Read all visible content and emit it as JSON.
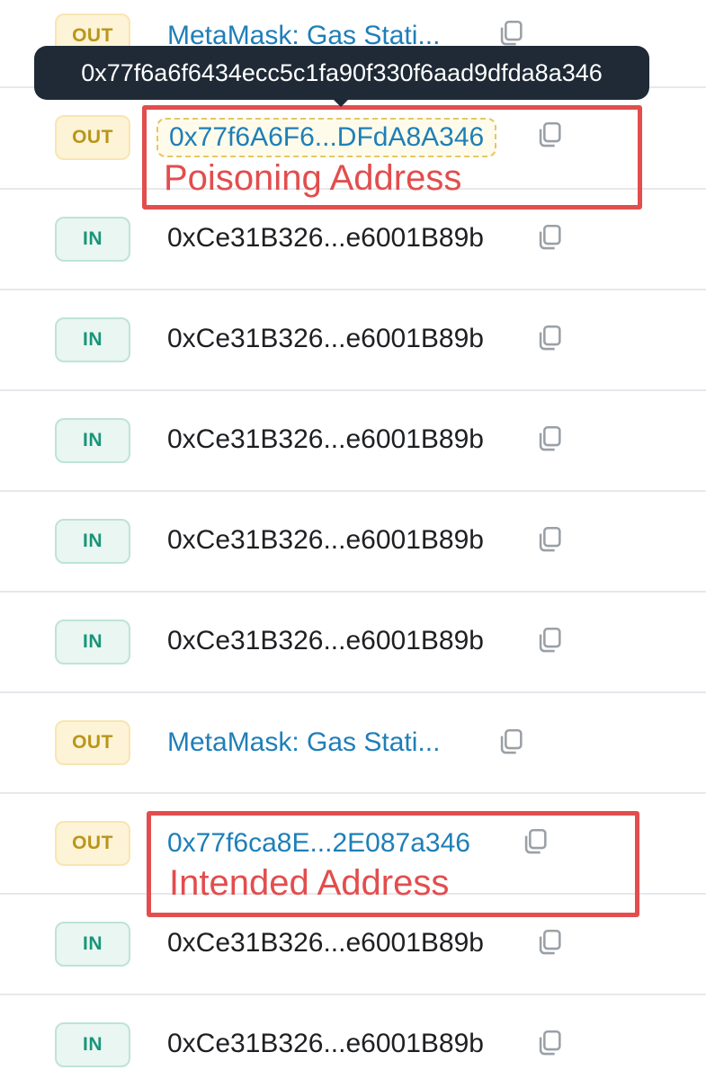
{
  "transactions": [
    {
      "direction": "OUT",
      "address": "MetaMask: Gas Stati...",
      "kind": "link"
    },
    {
      "direction": "OUT",
      "address": "0x77f6A6F6...DFdA8A346",
      "kind": "link"
    },
    {
      "direction": "IN",
      "address": "0xCe31B326...e6001B89b",
      "kind": "plain"
    },
    {
      "direction": "IN",
      "address": "0xCe31B326...e6001B89b",
      "kind": "plain"
    },
    {
      "direction": "IN",
      "address": "0xCe31B326...e6001B89b",
      "kind": "plain"
    },
    {
      "direction": "IN",
      "address": "0xCe31B326...e6001B89b",
      "kind": "plain"
    },
    {
      "direction": "IN",
      "address": "0xCe31B326...e6001B89b",
      "kind": "plain"
    },
    {
      "direction": "OUT",
      "address": "MetaMask: Gas Stati...",
      "kind": "link"
    },
    {
      "direction": "OUT",
      "address": "0x77f6ca8E...2E087a346",
      "kind": "link"
    },
    {
      "direction": "IN",
      "address": "0xCe31B326...e6001B89b",
      "kind": "plain"
    },
    {
      "direction": "IN",
      "address": "0xCe31B326...e6001B89b",
      "kind": "plain"
    }
  ],
  "tooltip": {
    "full_address": "0x77f6a6f6434ecc5c1fa90f330f6aad9dfda8a346"
  },
  "annotations": {
    "poisoning_label": "Poisoning Address",
    "intended_label": "Intended Address"
  },
  "icons": {
    "copy": "copy-icon"
  },
  "colors": {
    "out_badge_text": "#b8961a",
    "in_badge_text": "#199478",
    "link_text": "#1e7fb8",
    "highlight_red": "#e34d4d",
    "tooltip_bg": "#1f2a36"
  }
}
